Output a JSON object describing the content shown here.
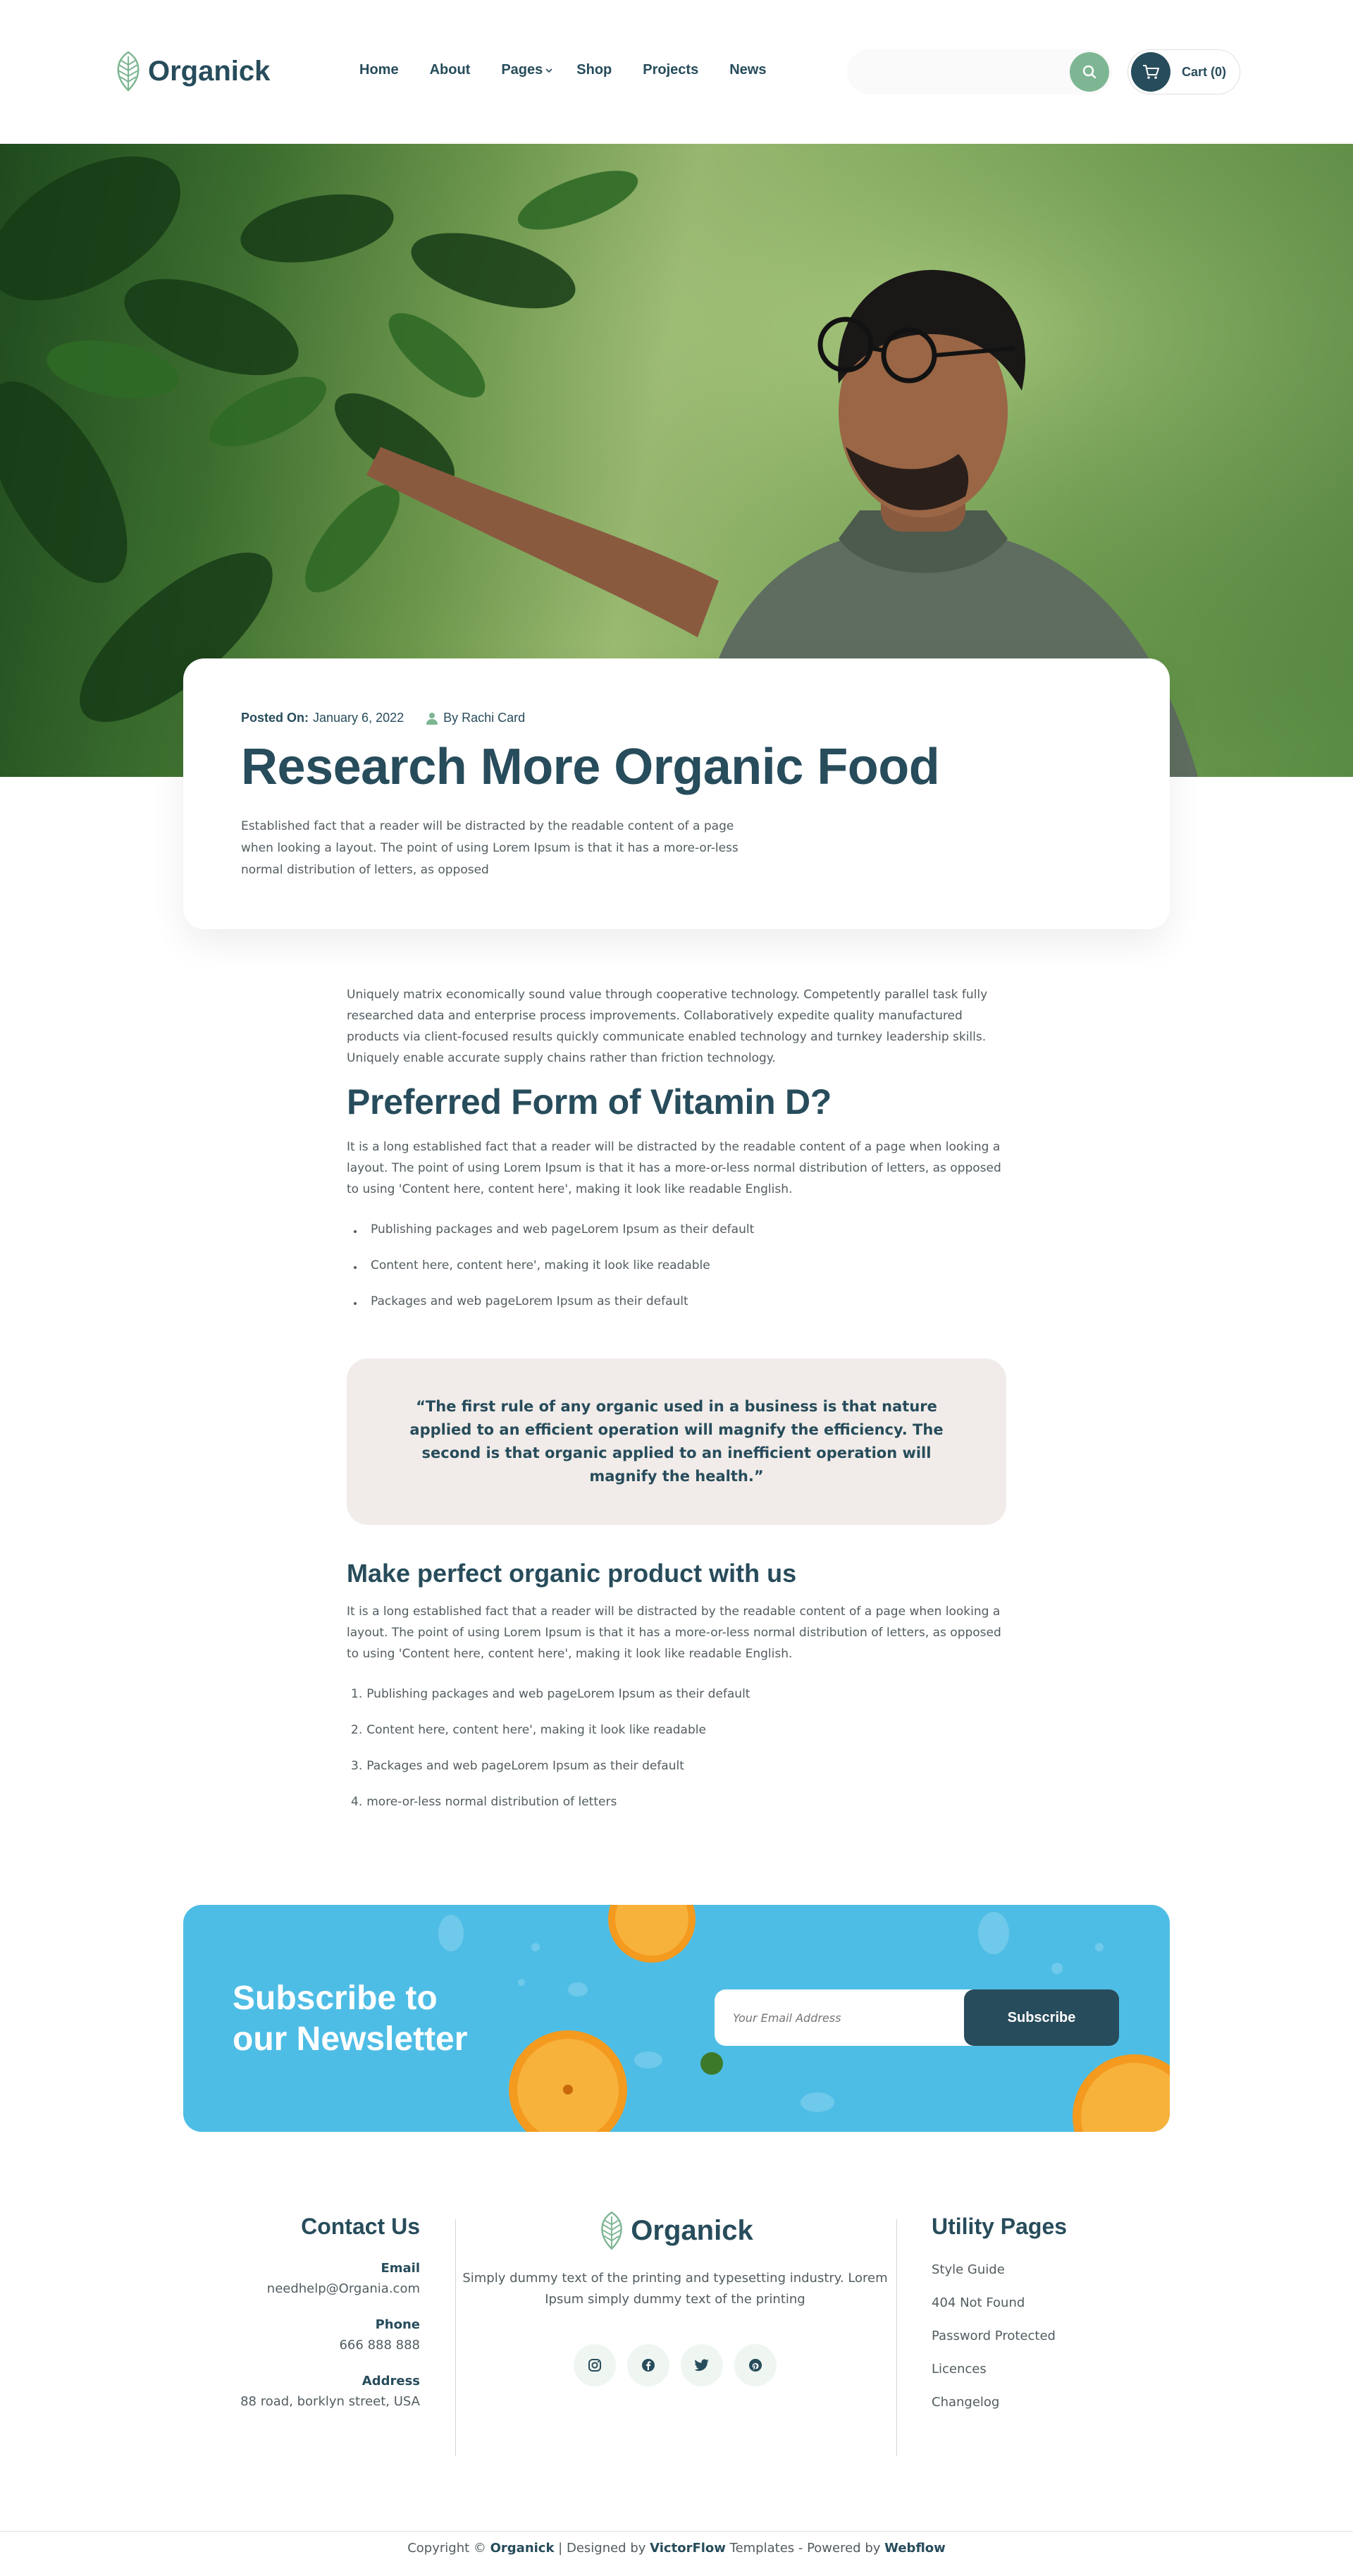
{
  "header": {
    "brand": "Organick",
    "nav": [
      {
        "label": "Home"
      },
      {
        "label": "About"
      },
      {
        "label": "Pages",
        "has_dropdown": true
      },
      {
        "label": "Shop"
      },
      {
        "label": "Projects"
      },
      {
        "label": "News"
      }
    ],
    "cart_label": "Cart (0)",
    "colors": {
      "primary": "#274C5B",
      "accent": "#7EB693"
    }
  },
  "hero": {
    "image": "photo of man with glasses examining green plants"
  },
  "intro": {
    "posted_label": "Posted On:",
    "date": "January 6, 2022",
    "author": "By Rachi Card",
    "title": "Research More Organic Food",
    "text": "Established fact that a reader will be distracted by the readable content of a page when looking a layout. The point of using Lorem Ipsum is that it has a more-or-less normal distribution of letters, as opposed"
  },
  "article": {
    "p1": "Uniquely matrix economically sound value through cooperative technology. Competently parallel task fully researched data and enterprise process improvements. Collaboratively expedite quality manufactured products via client-focused results quickly communicate enabled technology and turnkey leadership skills. Uniquely enable accurate supply chains rather than friction technology.",
    "h2": "Preferred Form of Vitamin D?",
    "p2": "It is a long established fact that a reader will be distracted by the readable content of a page when looking a layout. The point of using Lorem Ipsum is that it has a more-or-less normal distribution of letters, as opposed to using 'Content here, content here', making it look like readable English.",
    "bullets": [
      "Publishing packages and web pageLorem Ipsum as their default",
      "Content here, content here', making it look like readable",
      "Packages and web pageLorem Ipsum as their default"
    ],
    "quote": "“The first rule of any organic used in a business is that nature applied to an efficient operation will magnify the efficiency. The second is that organic applied to an inefficient operation will magnify the health.”",
    "h3": "Make perfect organic product with us",
    "p3": "It is a long established fact that a reader will be distracted by the readable content of a page when looking a layout. The point of using Lorem Ipsum is that it has a more-or-less normal distribution of letters, as opposed to using 'Content here, content here', making it look like readable English.",
    "numbered": [
      {
        "num": "1.",
        "text": "Publishing packages and web pageLorem Ipsum as their default"
      },
      {
        "num": "2.",
        "text": "Content here, content here', making it look like readable"
      },
      {
        "num": "3.",
        "text": "Packages and web pageLorem Ipsum as their default"
      },
      {
        "num": "4.",
        "text": "more-or-less normal distribution of letters"
      }
    ]
  },
  "newsletter": {
    "title_line1": "Subscribe to",
    "title_line2": "our Newsletter",
    "placeholder": "Your Email Address",
    "button": "Subscribe",
    "bg_color": "#4EBDE5"
  },
  "footer": {
    "contact": {
      "heading": "Contact Us",
      "email_label": "Email",
      "email": "needhelp@Organia.com",
      "phone_label": "Phone",
      "phone": "666 888 888",
      "address_label": "Address",
      "address": "88 road, borklyn street, USA"
    },
    "brand": "Organick",
    "about_text": "Simply dummy text of the printing and typesetting industry. Lorem Ipsum simply dummy text of the printing",
    "socials": [
      "instagram-icon",
      "facebook-icon",
      "twitter-icon",
      "pinterest-icon"
    ],
    "utility": {
      "heading": "Utility Pages",
      "links": [
        "Style Guide",
        "404 Not Found",
        "Password Protected",
        "Licences",
        "Changelog"
      ]
    }
  },
  "copyright": {
    "prefix": "Copyright © ",
    "brand": "Organick",
    "mid": " | Designed by ",
    "designer": "VictorFlow",
    "mid2": " Templates - Powered by ",
    "platform": "Webflow"
  }
}
